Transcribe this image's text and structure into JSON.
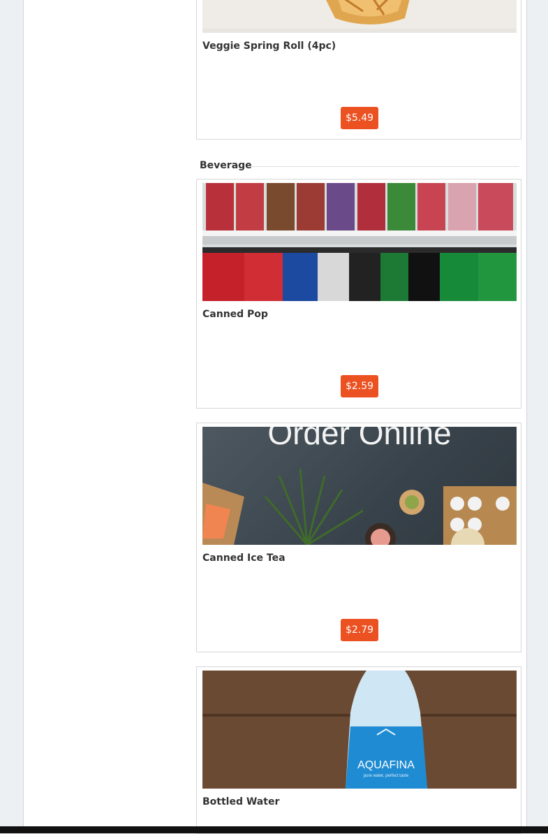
{
  "items": [
    {
      "name": "Veggie Spring Roll (4pc)",
      "price": "$5.49"
    },
    {
      "name": "Canned Pop",
      "price": "$2.59"
    },
    {
      "name": "Canned Ice Tea",
      "price": "$2.79"
    },
    {
      "name": "Bottled Water",
      "price": ""
    }
  ],
  "sections": {
    "beverage": "Beverage"
  },
  "images": {
    "ice_tea_banner": "Order Online",
    "water_label": "AQUAFINA",
    "water_tagline": "pure water, perfect taste"
  },
  "colors": {
    "accent": "#ec5122",
    "page_bg": "#ecf0f3"
  }
}
